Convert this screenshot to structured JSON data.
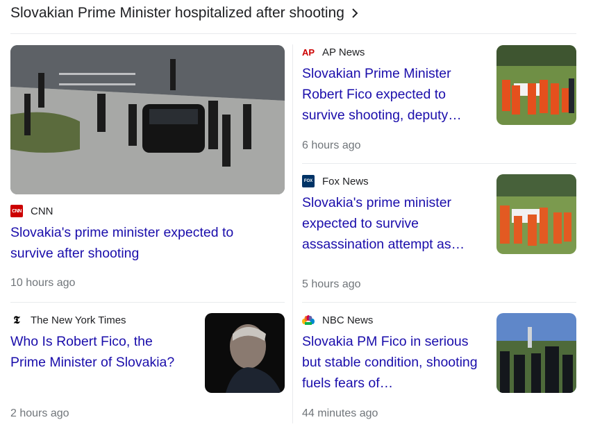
{
  "header": {
    "title": "Slovakian Prime Minister hospitalized after shooting"
  },
  "cards": [
    {
      "source": "CNN",
      "logo_text": "CNN",
      "title": "Slovakia's prime minister expected to survive after shooting",
      "time": "10 hours ago",
      "logo_color": "#cc0000"
    },
    {
      "source": "AP News",
      "logo_text": "AP",
      "title": "Slovakian Prime Minister Robert Fico expected to survive shooting, deputy…",
      "time": "6 hours ago",
      "logo_color": "#cc0000"
    },
    {
      "source": "Fox News",
      "logo_text": "FOX",
      "title": "Slovakia's prime minister expected to survive assassination attempt as…",
      "time": "5 hours ago",
      "logo_color": "#003366"
    },
    {
      "source": "The New York Times",
      "logo_text": "𝕿",
      "title": "Who Is Robert Fico, the Prime Minister of Slovakia?",
      "time": "2 hours ago",
      "logo_color": "#000000"
    },
    {
      "source": "NBC News",
      "logo_text": "",
      "title": "Slovakia PM Fico in serious but stable condition, shooting fuels fears of…",
      "time": "44 minutes ago",
      "logo_color": "#6460aa"
    }
  ],
  "colors": {
    "link": "#1a0dab",
    "meta": "#70757a",
    "divider": "#e8eaed"
  }
}
